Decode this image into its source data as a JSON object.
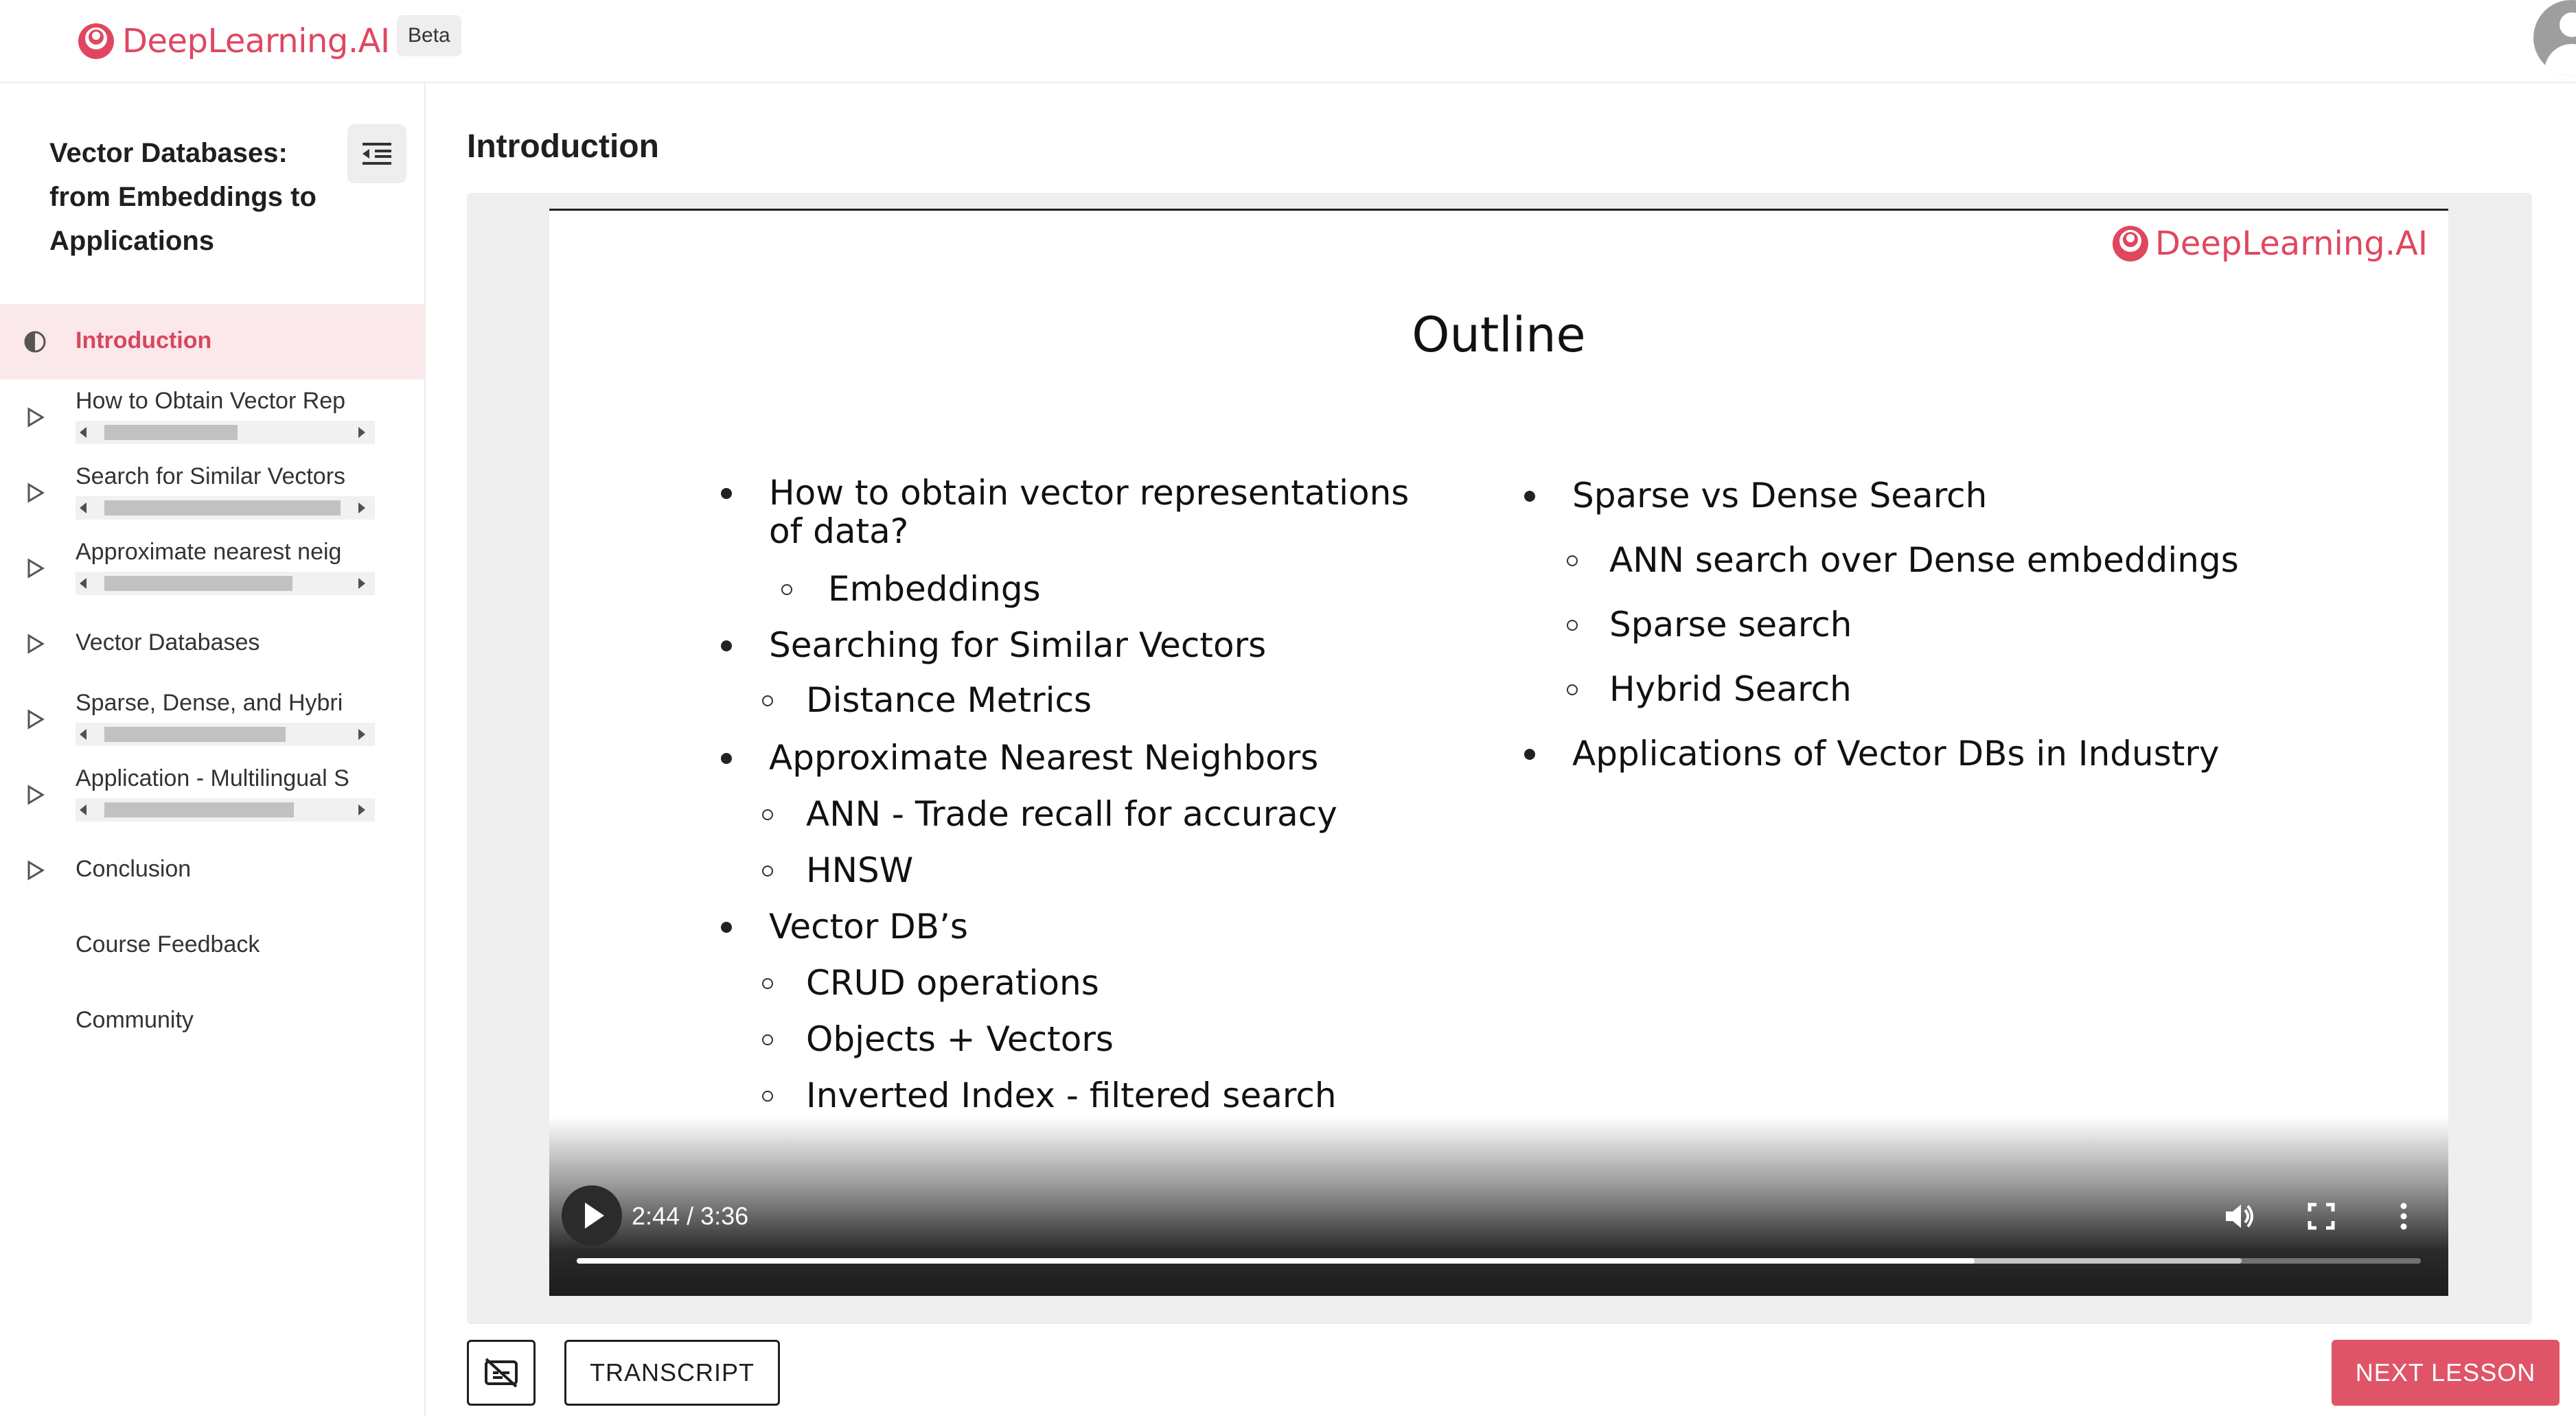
{
  "app": {
    "brand": "DeepLearning.AI",
    "badge": "Beta"
  },
  "sidebar": {
    "course_title": "Vector Databases: from Embeddings to Applications",
    "lessons": [
      {
        "label": "Introduction",
        "active": true
      },
      {
        "label": "How to Obtain Vector Rep"
      },
      {
        "label": "Search for Similar Vectors"
      },
      {
        "label": "Approximate nearest neig"
      },
      {
        "label": "Vector Databases"
      },
      {
        "label": "Sparse, Dense, and Hybri"
      },
      {
        "label": "Application - Multilingual S"
      },
      {
        "label": "Conclusion"
      },
      {
        "label": "Course Feedback"
      },
      {
        "label": "Community"
      }
    ]
  },
  "main": {
    "title": "Introduction",
    "slide": {
      "logo": "DeepLearning.AI",
      "title": "Outline",
      "left": [
        {
          "level": 1,
          "text": "How to obtain vector representations"
        },
        {
          "level": 1,
          "text": "of data?"
        },
        {
          "level": 2,
          "text": "Embeddings"
        },
        {
          "level": 1,
          "text": "Searching for Similar Vectors"
        },
        {
          "level": 2,
          "text": "Distance Metrics"
        },
        {
          "level": 1,
          "text": "Approximate Nearest Neighbors"
        },
        {
          "level": 2,
          "text": "ANN - Trade recall for accuracy"
        },
        {
          "level": 2,
          "text": "HNSW"
        },
        {
          "level": 1,
          "text": "Vector DB’s"
        },
        {
          "level": 2,
          "text": "CRUD operations"
        },
        {
          "level": 2,
          "text": "Objects + Vectors"
        },
        {
          "level": 2,
          "text": "Inverted Index - filtered search"
        }
      ],
      "right": [
        {
          "level": 1,
          "text": "Sparse vs Dense Search"
        },
        {
          "level": 2,
          "text": "ANN search over Dense embeddings"
        },
        {
          "level": 2,
          "text": "Sparse search"
        },
        {
          "level": 2,
          "text": "Hybrid Search"
        },
        {
          "level": 1,
          "text": "Applications of Vector DBs in Industry"
        }
      ]
    },
    "player": {
      "time": "2:44 / 3:36",
      "played_fraction": 0.758,
      "buffered_fraction": 0.903
    },
    "buttons": {
      "transcript": "TRANSCRIPT",
      "next": "NEXT LESSON"
    }
  },
  "icons": {
    "brand": "deeplearning-logo-icon",
    "collapse": "collapse-sidebar-icon",
    "active_lesson": "half-circle-icon",
    "lesson": "play-triangle-icon",
    "captions_off": "captions-off-icon",
    "volume": "volume-icon",
    "fullscreen": "fullscreen-icon",
    "more": "more-vertical-icon"
  },
  "colors": {
    "accent": "#e0475f",
    "active_bg": "#fbe8ea",
    "next_button": "#e05468"
  }
}
